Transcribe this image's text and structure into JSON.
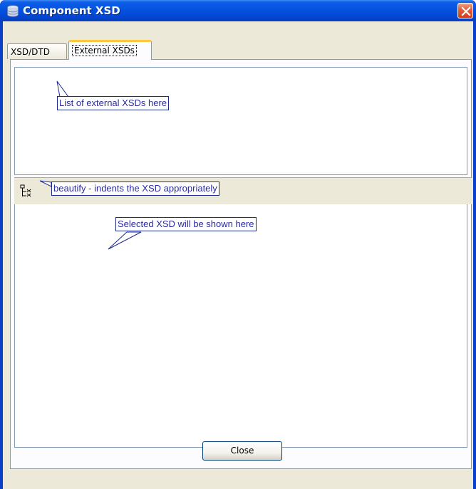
{
  "window": {
    "title": "Component XSD",
    "icon": "database-icon",
    "close_icon": "close-icon",
    "accent_color": "#0453e0",
    "close_color": "#d0401c"
  },
  "tabs": [
    {
      "label": "XSD/DTD",
      "selected": false
    },
    {
      "label": "External XSDs",
      "selected": true
    }
  ],
  "annotations": {
    "list": "List of external XSDs here",
    "beautify": "beautify - indents the XSD appropriately",
    "selected": "Selected XSD will be shown here"
  },
  "toolbar": {
    "beautify_icon": "tree-indent-icon"
  },
  "footer": {
    "close_label": "Close"
  }
}
